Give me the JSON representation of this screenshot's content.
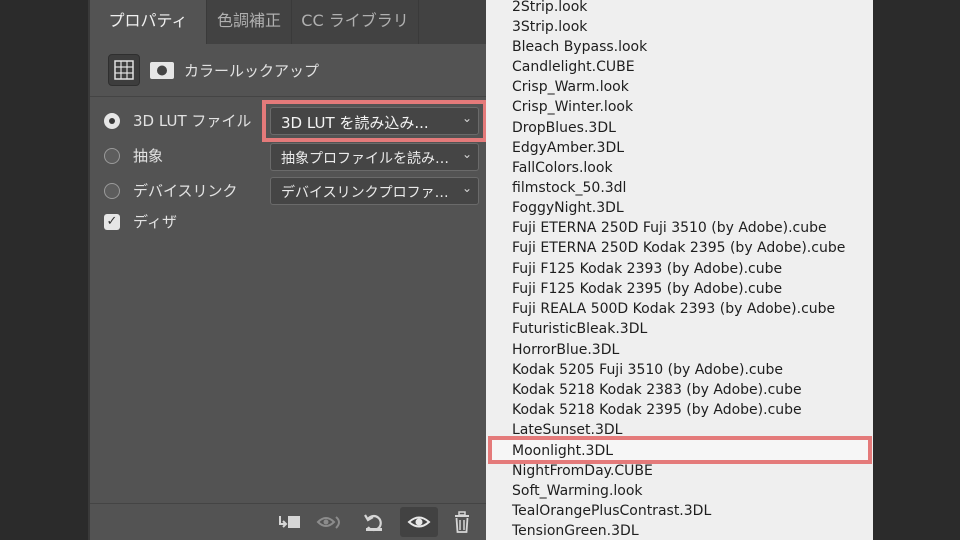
{
  "tabs": [
    {
      "label": "プロパティ",
      "active": true
    },
    {
      "label": "色調補正",
      "active": false
    },
    {
      "label": "CC ライブラリ",
      "active": false
    }
  ],
  "panel_title": "カラールックアップ",
  "top_icons": [
    "grid-table-icon",
    "layer-mask-icon"
  ],
  "options": [
    {
      "type": "radio",
      "label": "3D LUT ファイル",
      "checked": true,
      "dropdown": "3D LUT を読み込み..."
    },
    {
      "type": "radio",
      "label": "抽象",
      "checked": false,
      "dropdown": "抽象プロファイルを読み込み..."
    },
    {
      "type": "radio",
      "label": "デバイスリンク",
      "checked": false,
      "dropdown": "デバイスリンクプロファイルを読み込み..."
    },
    {
      "type": "checkbox",
      "label": "ディザ",
      "checked": true
    }
  ],
  "bottom_icons": [
    "clip-to-layer-icon",
    "view-previous-state-icon",
    "reset-icon",
    "visibility-eye-icon",
    "trash-icon"
  ],
  "lut_menu": [
    "2Strip.look",
    "3Strip.look",
    "Bleach Bypass.look",
    "Candlelight.CUBE",
    "Crisp_Warm.look",
    "Crisp_Winter.look",
    "DropBlues.3DL",
    "EdgyAmber.3DL",
    "FallColors.look",
    "filmstock_50.3dl",
    "FoggyNight.3DL",
    "Fuji ETERNA 250D Fuji 3510 (by Adobe).cube",
    "Fuji ETERNA 250D Kodak 2395 (by Adobe).cube",
    "Fuji F125 Kodak 2393 (by Adobe).cube",
    "Fuji F125 Kodak 2395 (by Adobe).cube",
    "Fuji REALA 500D Kodak 2393 (by Adobe).cube",
    "FuturisticBleak.3DL",
    "HorrorBlue.3DL",
    "Kodak 5205 Fuji 3510 (by Adobe).cube",
    "Kodak 5218 Kodak 2383 (by Adobe).cube",
    "Kodak 5218 Kodak 2395 (by Adobe).cube",
    "LateSunset.3DL",
    "Moonlight.3DL",
    "NightFromDay.CUBE",
    "Soft_Warming.look",
    "TealOrangePlusContrast.3DL",
    "TensionGreen.3DL"
  ],
  "highlighted_menu_item": "Moonlight.3DL",
  "colors": {
    "highlight": "#e47a7a",
    "panel": "#535353",
    "menu": "#efefef"
  }
}
